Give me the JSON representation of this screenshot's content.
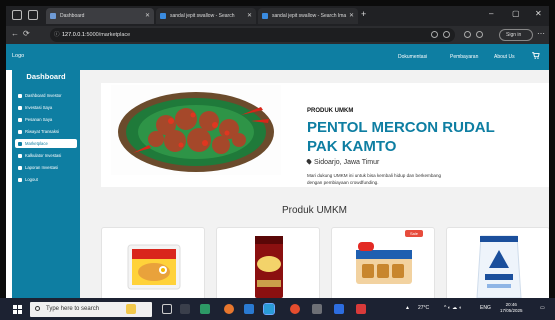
{
  "browser": {
    "tabs": [
      {
        "label": "Dashboard",
        "active": true
      },
      {
        "label": "sandal jepit swallow - Search",
        "active": false
      },
      {
        "label": "sandal jepit swallow - Search Ima",
        "active": false
      }
    ],
    "url_host": "127.0.0.1",
    "url_path": ":5000/marketplace",
    "signin_label": "Sign in"
  },
  "navbar": {
    "logo": "Logo",
    "links": [
      "Dokumentasi",
      "Pembayaran",
      "About Us"
    ]
  },
  "sidebar": {
    "title": "Dashboard",
    "items": [
      {
        "label": "Dashboard Investor",
        "icon": "user-icon",
        "active": false
      },
      {
        "label": "Investasi Saya",
        "icon": "chart-icon",
        "active": false
      },
      {
        "label": "Pesanan Saya",
        "icon": "cart-icon",
        "active": false
      },
      {
        "label": "Riwayat Transaksi",
        "icon": "history-icon",
        "active": false
      },
      {
        "label": "Marketplace",
        "icon": "store-icon",
        "active": true
      },
      {
        "label": "Kalkulator Investasi",
        "icon": "calculator-icon",
        "active": false
      },
      {
        "label": "Laporan Investasi",
        "icon": "report-icon",
        "active": false
      },
      {
        "label": "Logout",
        "icon": "logout-icon",
        "active": false
      }
    ]
  },
  "hero": {
    "tag": "PRODUK UMKM",
    "title": "PENTOL MERCON RUDAL PAK KAMTO",
    "location": "Sidoarjo, Jawa Timur",
    "description": "Mari dukung UMKM ini untuk bisa kembali hidup dan berkembang dengan pembiayaan crowdfunding."
  },
  "products": {
    "section_title": "Produk UMKM",
    "items": [
      {
        "brand": "Indomie",
        "kind": "noodle-pack"
      },
      {
        "brand": "Kapal Api",
        "kind": "coffee-pack"
      },
      {
        "brand": "Roma",
        "kind": "biscuit-pack",
        "badge": "Sale"
      },
      {
        "brand": "Segitiga Biru",
        "kind": "flour-pack"
      }
    ]
  },
  "taskbar": {
    "search_placeholder": "Type here to search",
    "weather": "27°C",
    "lang": "ENG",
    "time": "20:46",
    "date": "17/05/2025"
  },
  "colors": {
    "brand": "#0e7ea2",
    "sale": "#e74c3c"
  }
}
